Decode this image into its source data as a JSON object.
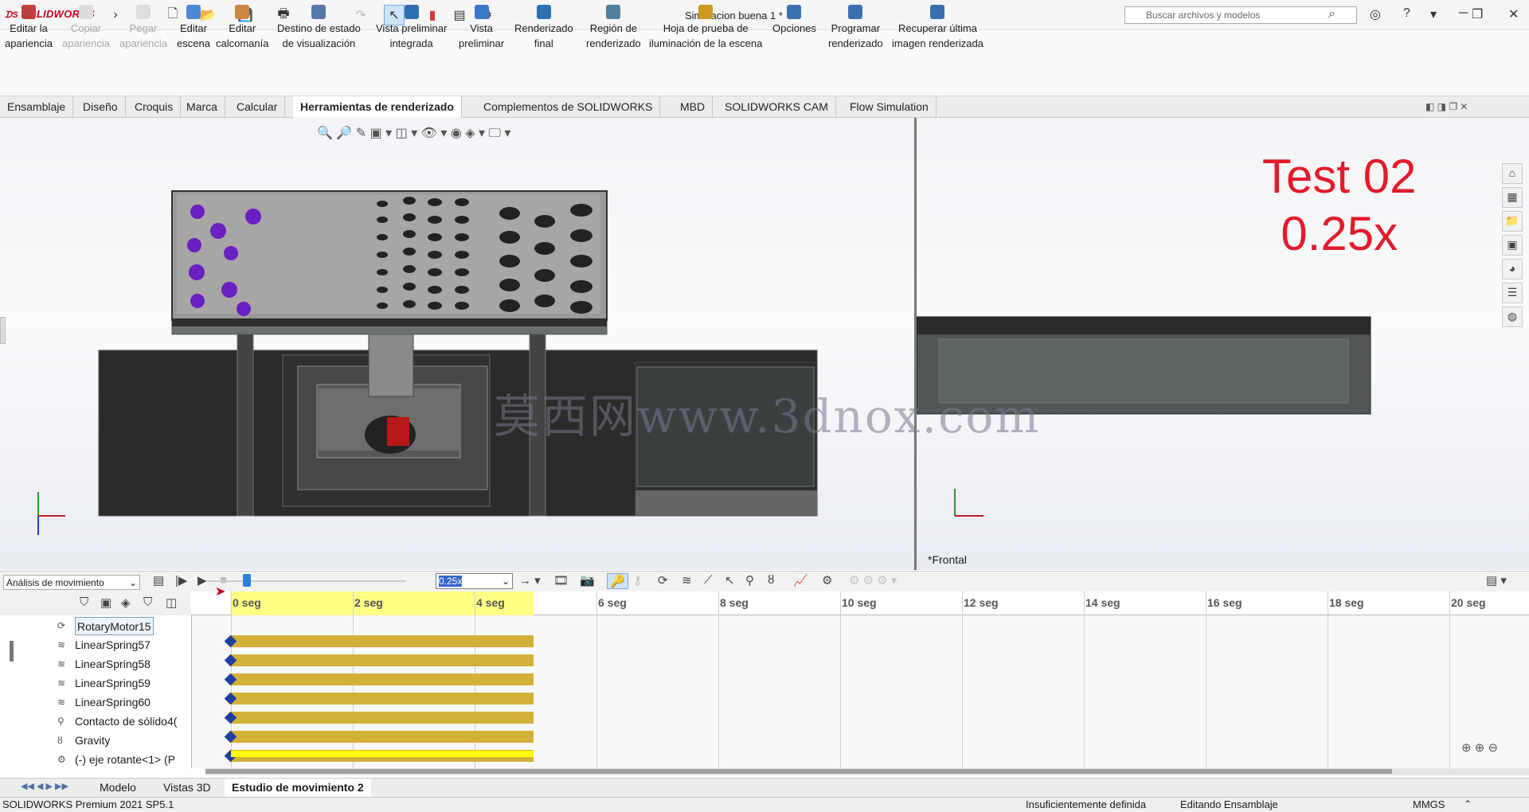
{
  "app": {
    "logo": "SOLIDWORKS",
    "title": "Simulacion buena 1 *",
    "search_placeholder": "Buscar archivos y modelos"
  },
  "ribbon": [
    {
      "label": "Editar la\napariencia",
      "enabled": true
    },
    {
      "label": "Copiar\napariencia",
      "enabled": false
    },
    {
      "label": "Pegar\napariencia",
      "enabled": false
    },
    {
      "label": "Editar\nescena",
      "enabled": true
    },
    {
      "label": "Editar\ncalcomanía",
      "enabled": true
    },
    {
      "label": "Destino de estado\nde visualización",
      "enabled": true
    },
    {
      "label": "Vista preliminar\nintegrada",
      "enabled": true
    },
    {
      "label": "Vista\npreliminar",
      "enabled": true
    },
    {
      "label": "Renderizado\nfinal",
      "enabled": true
    },
    {
      "label": "Región de\nrenderizado",
      "enabled": true
    },
    {
      "label": "Hoja de prueba de\niluminación de la escena",
      "enabled": true
    },
    {
      "label": "Opciones",
      "enabled": true
    },
    {
      "label": "Programar\nrenderizado",
      "enabled": true
    },
    {
      "label": "Recuperar última\nimagen renderizada",
      "enabled": true
    }
  ],
  "tabs": [
    "Ensamblaje",
    "Diseño",
    "Croquis",
    "Marca",
    "Calcular",
    "Herramientas de renderizado",
    "Complementos de SOLIDWORKS",
    "MBD",
    "SOLIDWORKS CAM",
    "Flow Simulation"
  ],
  "active_tab": "Herramientas de renderizado",
  "viewport": {
    "overlay_line1": "Test 02",
    "overlay_line2": "0.25x",
    "watermark": "莫西网www.3dnox.com",
    "view_name": "*Frontal"
  },
  "motion": {
    "analysis_type": "Análisis de movimiento",
    "playback_speed": "0.25x",
    "time_labels": [
      "0 seg",
      "2 seg",
      "4 seg",
      "6 seg",
      "8 seg",
      "10 seg",
      "12 seg",
      "14 seg",
      "16 seg",
      "18 seg",
      "20 seg"
    ],
    "tree_items": [
      "RotaryMotor15",
      "LinearSpring57",
      "LinearSpring58",
      "LinearSpring59",
      "LinearSpring60",
      "Contacto de sólido4(",
      "Gravity",
      "(-) eje rotante<1> (P"
    ]
  },
  "bottom_tabs": [
    "Modelo",
    "Vistas 3D",
    "Estudio de movimiento 2"
  ],
  "active_bottom_tab": "Estudio de movimiento 2",
  "status": {
    "version": "SOLIDWORKS Premium 2021 SP5.1",
    "definition": "Insuficientemente definida",
    "mode": "Editando Ensamblaje",
    "units": "MMGS"
  }
}
